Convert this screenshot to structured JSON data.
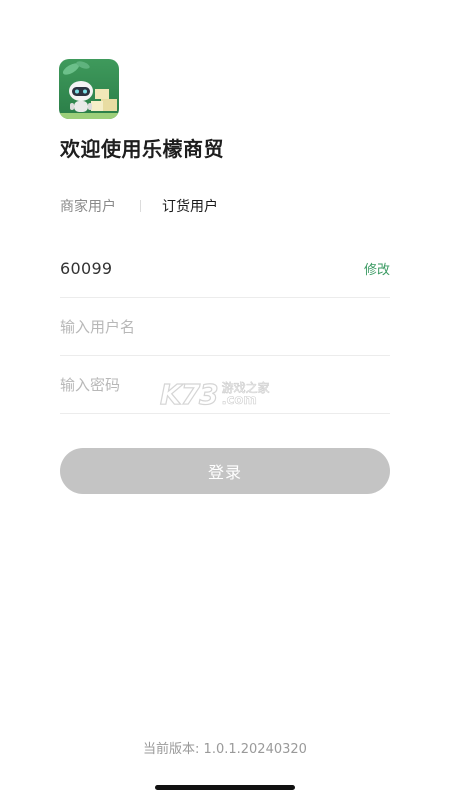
{
  "app": {
    "welcome_title": "欢迎使用乐檬商贸"
  },
  "tabs": [
    {
      "label": "商家用户",
      "active": false
    },
    {
      "label": "订货用户",
      "active": true
    }
  ],
  "form": {
    "code_value": "60099",
    "modify_label": "修改",
    "username_placeholder": "输入用户名",
    "password_placeholder": "输入密码"
  },
  "login_button_label": "登录",
  "version_text": "当前版本: 1.0.1.20240320",
  "watermark": {
    "logo": "K73",
    "line1": "游戏之家",
    "line2": ".com"
  },
  "colors": {
    "accent": "#3a9a62",
    "button_disabled": "#c4c4c4",
    "logo_green": "#2f8f4e"
  },
  "icons": {
    "app_logo": "robot-mascot-icon"
  }
}
